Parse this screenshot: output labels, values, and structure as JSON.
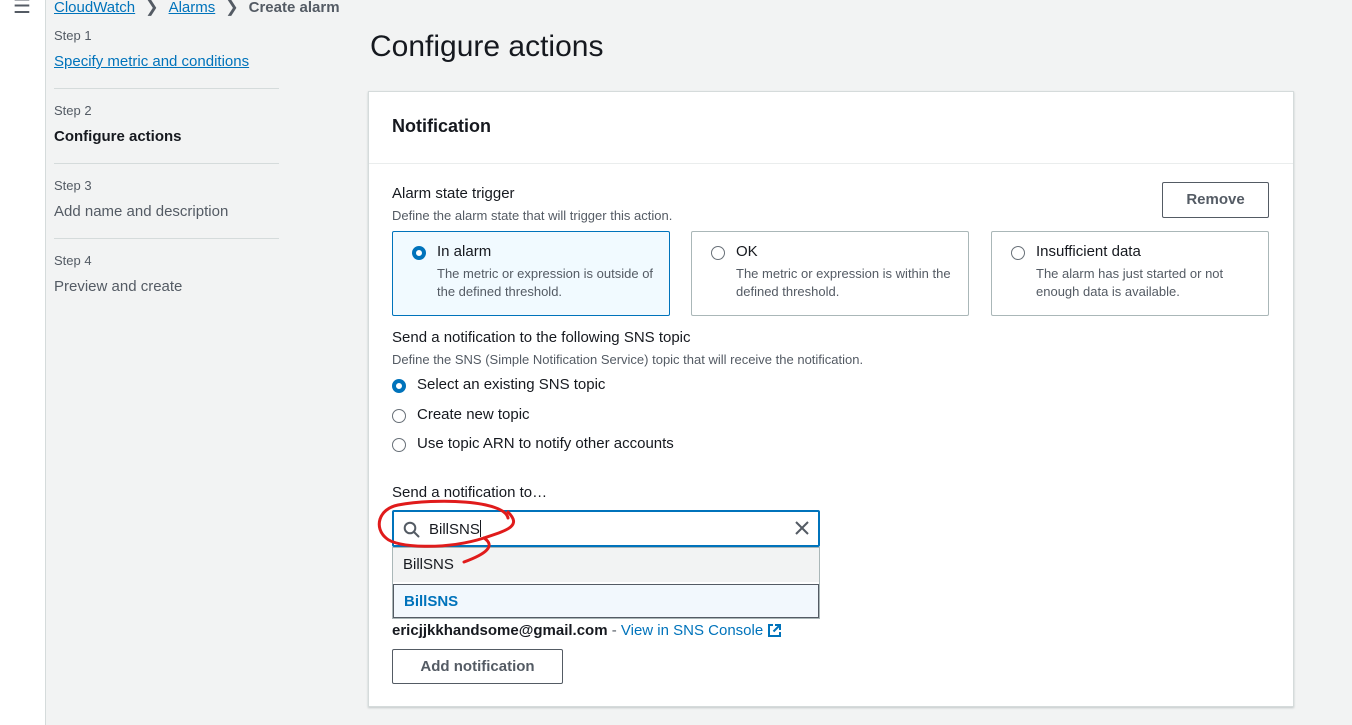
{
  "breadcrumb": {
    "items": [
      "CloudWatch",
      "Alarms"
    ],
    "current": "Create alarm"
  },
  "steps": [
    {
      "num": "Step 1",
      "title": "Specify metric and conditions",
      "state": "link"
    },
    {
      "num": "Step 2",
      "title": "Configure actions",
      "state": "active"
    },
    {
      "num": "Step 3",
      "title": "Add name and description",
      "state": "default"
    },
    {
      "num": "Step 4",
      "title": "Preview and create",
      "state": "default"
    }
  ],
  "page": {
    "title": "Configure actions"
  },
  "notification": {
    "title": "Notification",
    "remove_label": "Remove",
    "trigger": {
      "label": "Alarm state trigger",
      "desc": "Define the alarm state that will trigger this action.",
      "options": [
        {
          "title": "In alarm",
          "desc": "The metric or expression is outside of the defined threshold.",
          "selected": true
        },
        {
          "title": "OK",
          "desc": "The metric or expression is within the defined threshold.",
          "selected": false
        },
        {
          "title": "Insufficient data",
          "desc": "The alarm has just started or not enough data is available.",
          "selected": false
        }
      ]
    },
    "sns": {
      "label": "Send a notification to the following SNS topic",
      "desc": "Define the SNS (Simple Notification Service) topic that will receive the notification.",
      "options": [
        {
          "label": "Select an existing SNS topic",
          "selected": true
        },
        {
          "label": "Create new topic",
          "selected": false
        },
        {
          "label": "Use topic ARN to notify other accounts",
          "selected": false
        }
      ]
    },
    "send_to": {
      "label": "Send a notification to…",
      "search_value": "BillSNS",
      "dropdown_header": "BillSNS",
      "dropdown_item": "BillSNS"
    },
    "email": "ericjjkkhandsome@gmail.com",
    "email_sep": " - ",
    "console_link": "View in SNS Console",
    "add_label": "Add notification"
  },
  "colors": {
    "accent": "#0073bb",
    "annotation": "#e01b1b"
  }
}
